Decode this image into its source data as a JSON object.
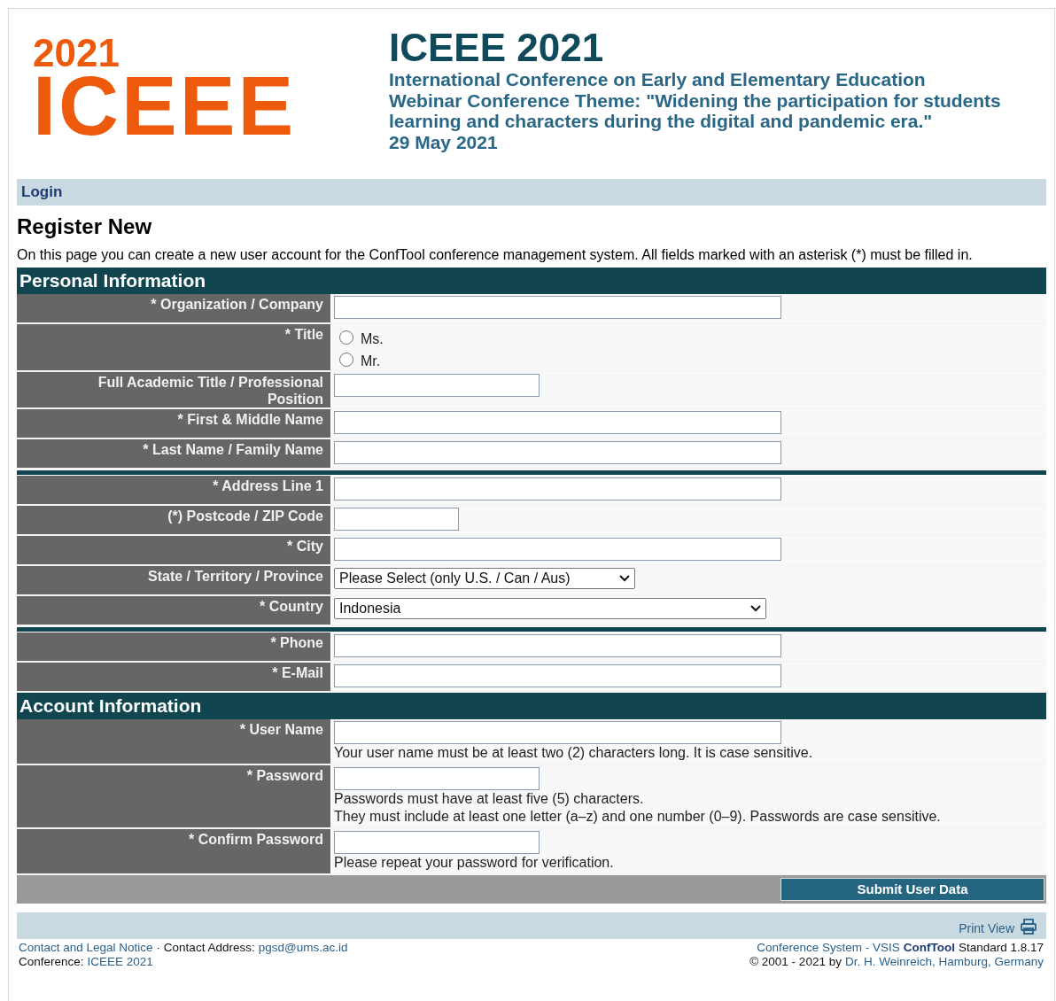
{
  "logo": {
    "year": "2021",
    "name": "ICEEE"
  },
  "header": {
    "title": "ICEEE 2021",
    "lines": [
      "International Conference on Early and Elementary Education",
      "Webinar Conference Theme: \"Widening the participation for students learning and characters during the digital and pandemic era.\"",
      "29 May 2021"
    ]
  },
  "nav": {
    "link": "Login"
  },
  "page": {
    "heading": "Register New",
    "intro": "On this page you can create a new user account for the ConfTool conference management system. All fields marked with an asterisk (*) must be filled in."
  },
  "sections": [
    {
      "title": "Personal Information",
      "groups": [
        [
          {
            "label": "* Organization / Company",
            "kind": "wide"
          },
          {
            "label": "* Title",
            "kind": "radio",
            "options": [
              {
                "label": "Ms.",
                "selected": false
              },
              {
                "label": "Mr.",
                "selected": false
              }
            ]
          },
          {
            "label": "Full Academic Title / Professional Position",
            "kind": "medium"
          },
          {
            "label": "* First & Middle Name",
            "kind": "wide"
          },
          {
            "label": "* Last Name / Family Name",
            "kind": "wide"
          }
        ],
        [
          {
            "label": "* Address Line 1",
            "kind": "wide"
          },
          {
            "label": "(*) Postcode / ZIP Code",
            "kind": "short"
          },
          {
            "label": "* City",
            "kind": "wide"
          },
          {
            "label": "State / Territory / Province",
            "kind": "dropdown",
            "value": "Please Select (only U.S. / Can / Aus)"
          },
          {
            "label": "* Country",
            "kind": "widedropdown",
            "value": "Indonesia"
          }
        ],
        [
          {
            "label": "* Phone",
            "kind": "wide"
          },
          {
            "label": "* E-Mail",
            "kind": "wide"
          }
        ]
      ]
    },
    {
      "title": "Account Information",
      "groups": [
        [
          {
            "label": "* User Name",
            "kind": "wide",
            "help": [
              "Your user name must be at least two (2) characters long. It is case sensitive."
            ]
          },
          {
            "label": "* Password",
            "kind": "medium",
            "help": [
              "Passwords must have at least five (5) characters.",
              "They must include at least one letter (a–z) and one number (0–9). Passwords are case sensitive."
            ]
          },
          {
            "label": "* Confirm Password",
            "kind": "medium",
            "help": [
              "Please repeat your password for verification."
            ]
          }
        ]
      ]
    }
  ],
  "submit": "Submit User Data",
  "print_view": "Print View",
  "footer": {
    "left": [
      [
        {
          "text": "Contact and Legal Notice",
          "kind": "link"
        },
        {
          "text": "· Contact Address:",
          "kind": "plain"
        },
        {
          "text": "pgsd@ums.ac.id",
          "kind": "link"
        }
      ],
      [
        {
          "text": "Conference:",
          "kind": "plain"
        },
        {
          "text": "ICEEE 2021",
          "kind": "link"
        }
      ]
    ],
    "right": [
      [
        {
          "text": "Conference System - VSIS",
          "kind": "link"
        },
        {
          "text": "ConfTool",
          "kind": "product"
        },
        {
          "text": "Standard 1.8.17",
          "kind": "plain"
        }
      ],
      [
        {
          "text": "© 2001 - 2021 by",
          "kind": "plain"
        },
        {
          "text": "Dr. H. Weinreich, Hamburg, Germany",
          "kind": "link"
        }
      ]
    ]
  }
}
